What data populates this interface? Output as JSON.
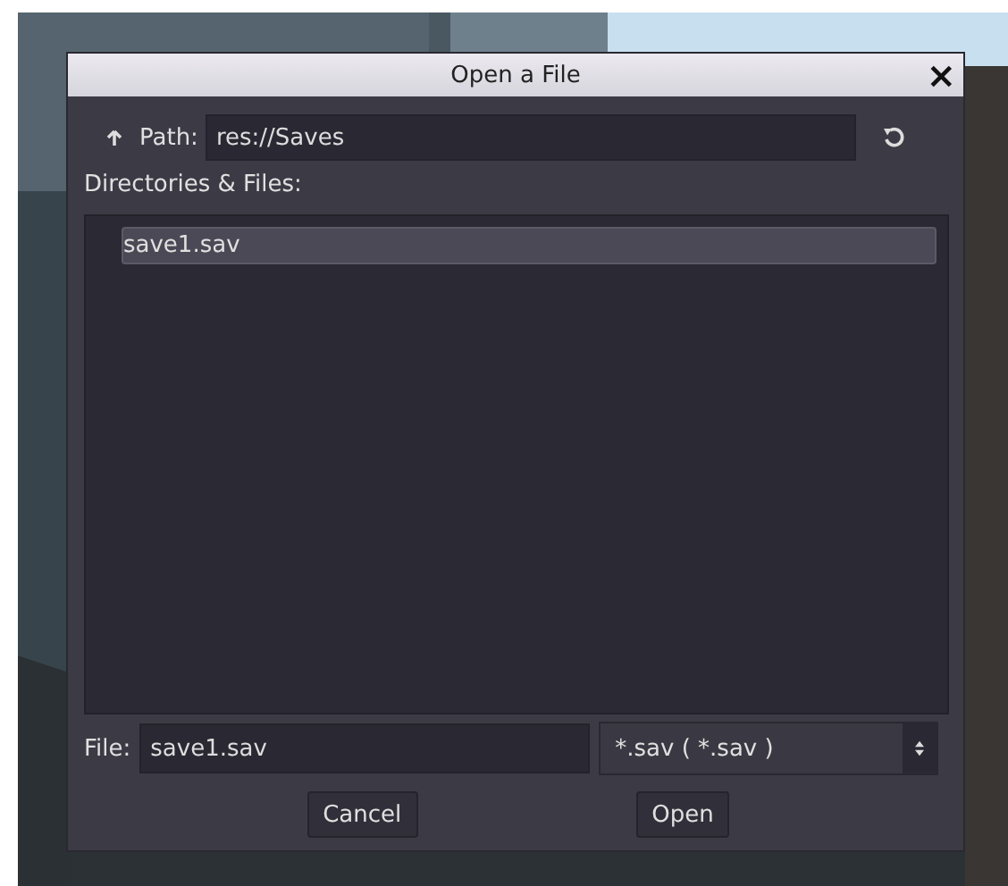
{
  "window": {
    "title": "Open a File",
    "close": "×"
  },
  "path": {
    "label": "Path:",
    "value": "res://Saves"
  },
  "list_label": "Directories & Files:",
  "files": [
    {
      "name": "save1.sav",
      "selected": true
    }
  ],
  "file": {
    "label": "File:",
    "value": "save1.sav"
  },
  "filter": {
    "value": "*.sav ( *.sav )"
  },
  "buttons": [
    "Cancel",
    "Open"
  ]
}
